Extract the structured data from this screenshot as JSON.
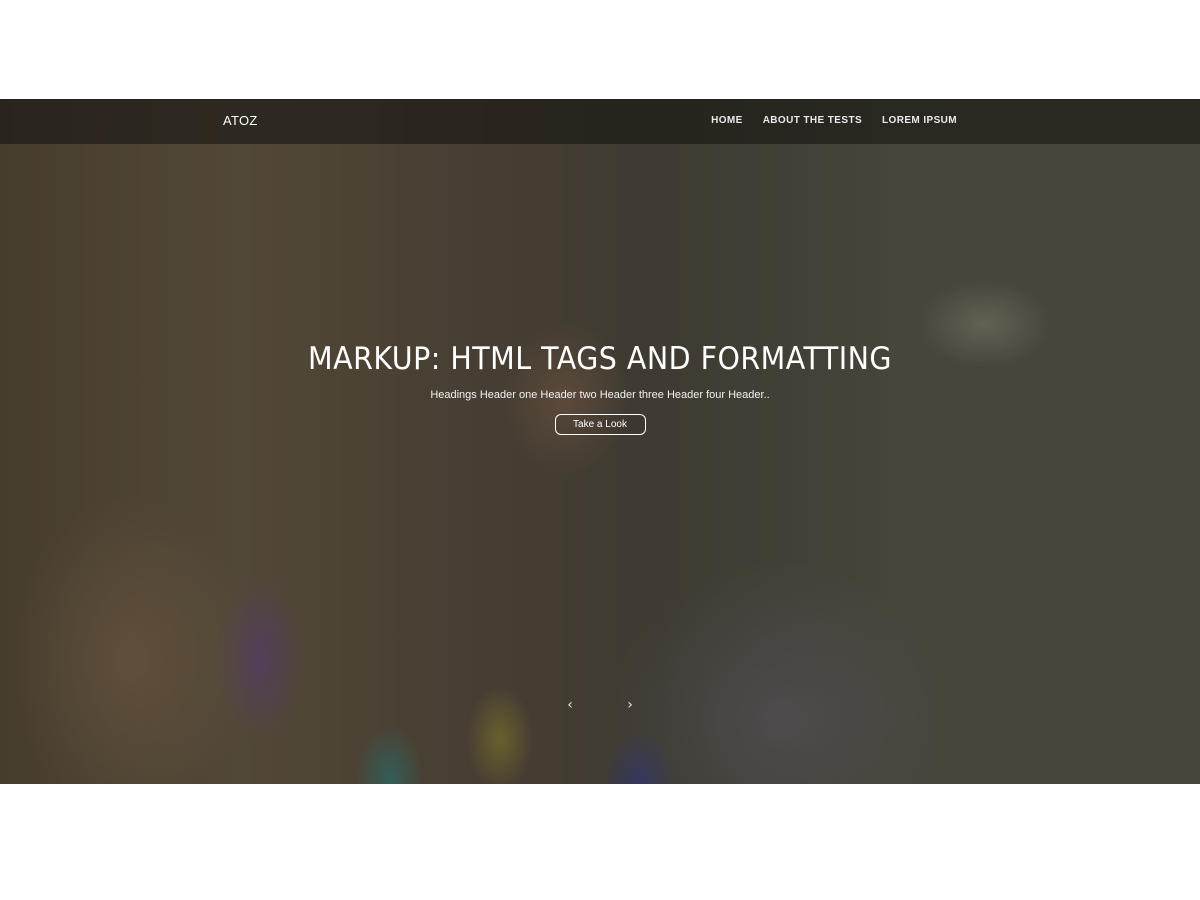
{
  "navbar": {
    "brand": "ATOZ",
    "links": [
      {
        "label": "HOME"
      },
      {
        "label": "ABOUT THE TESTS"
      },
      {
        "label": "LOREM IPSUM"
      }
    ]
  },
  "hero": {
    "title": "MARKUP: HTML TAGS AND FORMATTING",
    "excerpt": "Headings Header one Header two Header three Header four Header..",
    "cta_label": "Take a Look",
    "prev_icon": "chevron-left-icon",
    "next_icon": "chevron-right-icon"
  },
  "colors": {
    "page_background": "#ffffff",
    "navbar_background": "#2a2520",
    "text": "#ffffff"
  }
}
